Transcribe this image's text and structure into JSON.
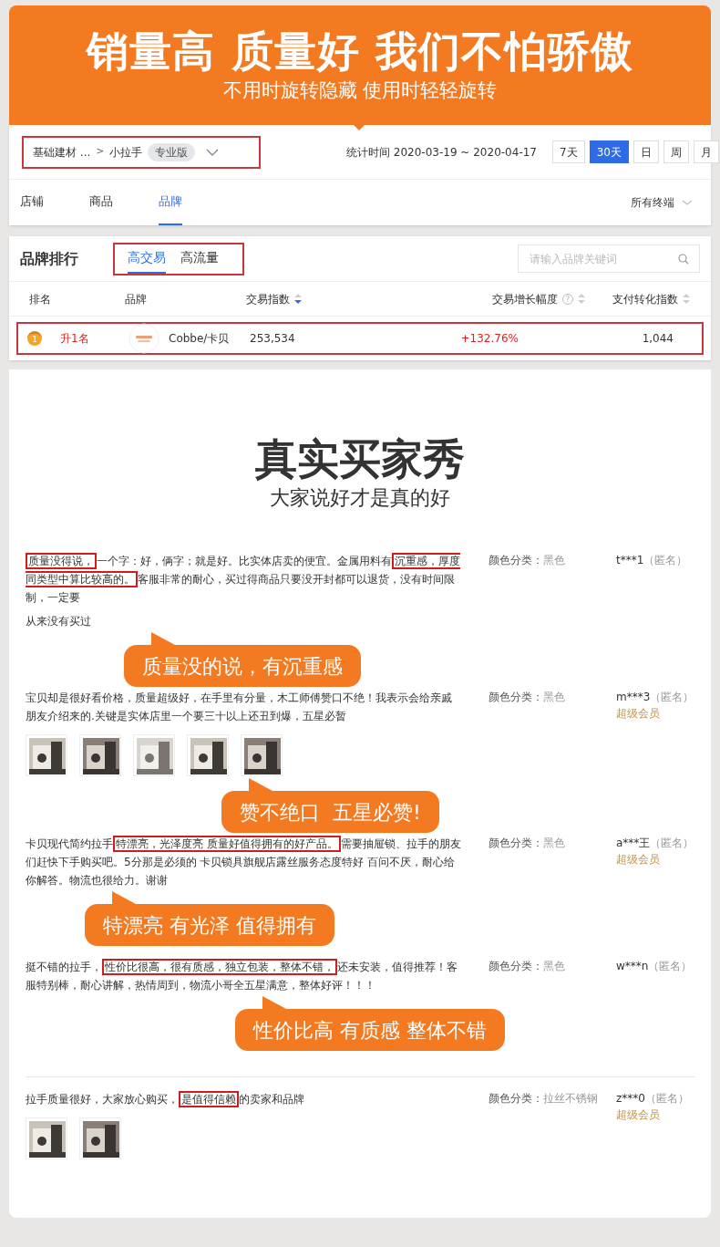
{
  "banner": {
    "title": "销量高 质量好 我们不怕骄傲",
    "subtitle": "不用时旋转隐藏 使用时轻轻旋转"
  },
  "filter": {
    "breadcrumb": "基础建材 ...",
    "separator": ">",
    "category": "小拉手",
    "badge": "专业版",
    "period": "统计时间 2020-03-19 ~ 2020-04-17",
    "ranges": [
      {
        "label": "7天",
        "selected": false
      },
      {
        "label": "30天",
        "selected": true
      },
      {
        "label": "日",
        "selected": false
      },
      {
        "label": "周",
        "selected": false
      },
      {
        "label": "月",
        "selected": false
      }
    ]
  },
  "nav_tabs": [
    {
      "label": "店铺",
      "selected": false
    },
    {
      "label": "商品",
      "selected": false
    },
    {
      "label": "品牌",
      "selected": true
    }
  ],
  "device_filter": "所有终端",
  "ranking": {
    "title": "品牌排行",
    "tabs": [
      {
        "label": "高交易",
        "selected": true
      },
      {
        "label": "高流量",
        "selected": false
      }
    ],
    "search_placeholder": "请输入品牌关键词",
    "columns": [
      {
        "label": "排名"
      },
      {
        "label": "品牌"
      },
      {
        "label": "交易指数",
        "sorted": true
      },
      {
        "label": "交易增长幅度",
        "sorted": false,
        "help": "?"
      },
      {
        "label": "支付转化指数",
        "sorted": false
      }
    ],
    "rows": [
      {
        "rank": "1",
        "change": "升1名",
        "brand": "Cobbe/卡贝",
        "trade_index": "253,534",
        "growth": "+132.76%",
        "conversion": "1,044"
      }
    ]
  },
  "reviews_header": {
    "title": "真实买家秀",
    "subtitle": "大家说好才是真的好"
  },
  "reviews": [
    {
      "parts": [
        {
          "text": "质量没得说，",
          "highlighted": true
        },
        {
          "text": "一个字：好，俩字；就是好。比实体店卖的便宜。金属用料有",
          "highlighted": false
        },
        {
          "text": "沉重感，厚度同类型中算比较高的。",
          "highlighted": true
        },
        {
          "text": "客服非常的耐心，买过得商品只要没开封都可以退货，没有时间限制，一定要",
          "highlighted": false
        }
      ],
      "tail": "从来没有买过",
      "color_label": "颜色分类：",
      "color_value": "黑色",
      "user": "t***1",
      "anonymous": "（匿名）",
      "callout": "质量没的说，有沉重感"
    },
    {
      "parts": [
        {
          "text": "宝贝却是很好看价格，质量超级好，在手里有分量，木工师傅赞口不绝！我表示会给亲戚朋友介绍来的.关键是实体店里一个要三十以上还丑到爆，五星必暂",
          "highlighted": false
        }
      ],
      "photos": [
        {
          "kind": "picture"
        },
        {
          "kind": "picture"
        },
        {
          "kind": "picture"
        },
        {
          "kind": "picture"
        },
        {
          "kind": "picture"
        }
      ],
      "color_label": "颜色分类：",
      "color_value": "黑色",
      "user": "m***3",
      "anonymous": "（匿名）",
      "member": "超级会员",
      "callout": "赞不绝口  五星必赞!"
    },
    {
      "parts": [
        {
          "text": "卡贝现代简约拉手",
          "highlighted": false
        },
        {
          "text": "特漂亮，光泽度亮 质量好值得拥有的好产品。",
          "highlighted": true
        },
        {
          "text": "需要抽屉锁、拉手的朋友们赶快下手购买吧。5分那是必须的 卡贝锁具旗舰店露丝服务态度特好 百问不厌，耐心给你解答。物流也很给力。谢谢",
          "highlighted": false
        }
      ],
      "color_label": "颜色分类：",
      "color_value": "黑色",
      "user": "a***王",
      "anonymous": "（匿名）",
      "member": "超级会员",
      "callout": "特漂亮 有光泽 值得拥有"
    },
    {
      "parts": [
        {
          "text": "挺不错的拉手，",
          "highlighted": false
        },
        {
          "text": "性价比很高，很有质感，独立包装，整体不错，",
          "highlighted": true
        },
        {
          "text": "还未安装，值得推荐！客服特别棒，耐心讲解，热情周到，物流小哥全五星满意，整体好评！！！",
          "highlighted": false
        }
      ],
      "color_label": "颜色分类：",
      "color_value": "黑色",
      "user": "w***n",
      "anonymous": "（匿名）",
      "callout": "性价比高 有质感 整体不错"
    },
    {
      "parts": [
        {
          "text": "拉手质量很好，大家放心购买，",
          "highlighted": false
        },
        {
          "text": "是值得信赖",
          "highlighted": true
        },
        {
          "text": "的卖家和品牌",
          "highlighted": false
        }
      ],
      "photos": [
        {
          "kind": "picture"
        },
        {
          "kind": "picture"
        }
      ],
      "color_label": "颜色分类：",
      "color_value": "拉丝不锈钢",
      "user": "z***0",
      "anonymous": "（匿名）",
      "member": "超级会员"
    }
  ]
}
